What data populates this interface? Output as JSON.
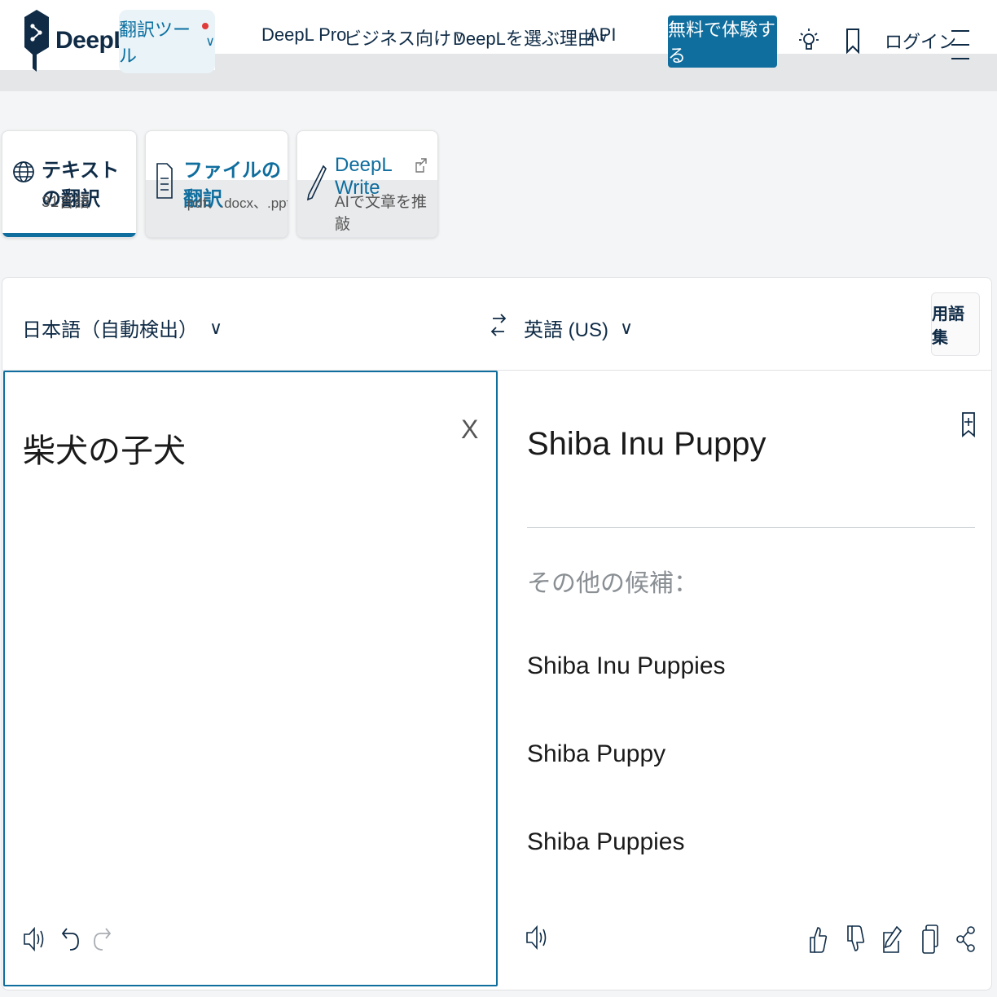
{
  "header": {
    "brand": "DeepL",
    "tools_label": "翻訳ツール",
    "nav": [
      {
        "label": "DeepL Pro",
        "has_menu": false
      },
      {
        "label": "ビジネス向け",
        "has_menu": true
      },
      {
        "label": "DeepLを選ぶ理由",
        "has_menu": true
      },
      {
        "label": "API",
        "has_menu": false
      }
    ],
    "cta_label": "無料で体験する",
    "login_label": "ログイン",
    "icons": [
      "lightbulb-icon",
      "bookmark-icon",
      "menu-icon"
    ]
  },
  "modes": [
    {
      "title": "テキストの翻訳",
      "sub": "31言語",
      "active": true,
      "icon": "globe-icon"
    },
    {
      "title": "ファイルの翻訳",
      "sub": ".pdf、.docx、.pptx",
      "active": false,
      "icon": "document-icon"
    },
    {
      "title": "DeepL Write",
      "sub": "AIで文章を推敲",
      "active": false,
      "icon": "pen-icon"
    }
  ],
  "translator": {
    "source_lang": "日本語（自動検出）",
    "target_lang": "英語 (US)",
    "glossary_label": "用語集",
    "source_text": "柴犬の子犬",
    "clear_label": "X",
    "target_text": "Shiba Inu Puppy",
    "alternatives_label": "その他の候補：",
    "alternatives": [
      "Shiba Inu Puppies",
      "Shiba Puppy",
      "Shiba Puppies"
    ]
  },
  "colors": {
    "brand_navy": "#0f2b46",
    "accent_blue": "#0f6e9e",
    "notification_red": "#e03b3b"
  }
}
